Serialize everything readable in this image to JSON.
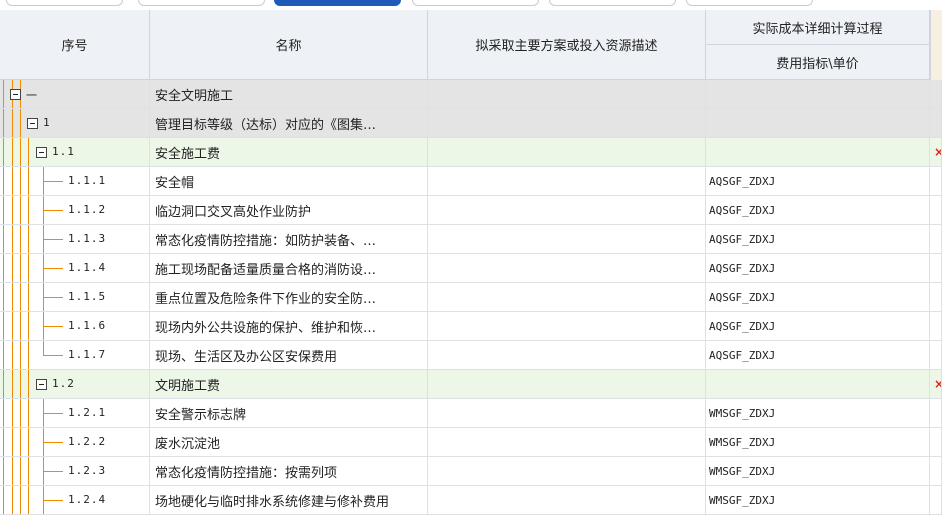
{
  "header": {
    "col_no": "序号",
    "col_name": "名称",
    "col_desc": "拟采取主要方案或投入资源描述",
    "group_cost": "实际成本详细计算过程",
    "col_index": "费用指标\\单价"
  },
  "rows": [
    {
      "level": 0,
      "no": "一",
      "name": "安全文明施工",
      "index": "",
      "expandable": true
    },
    {
      "level": 1,
      "no": "1",
      "name": "管理目标等级（达标）对应的《图集…",
      "index": "",
      "expandable": true
    },
    {
      "level": 2,
      "no": "1.1",
      "name": "安全施工费",
      "index": "",
      "expandable": true,
      "flag": "×"
    },
    {
      "level": 3,
      "no": "1.1.1",
      "name": "安全帽",
      "index": "AQSGF_ZDXJ"
    },
    {
      "level": 3,
      "no": "1.1.2",
      "name": "临边洞口交叉高处作业防护",
      "index": "AQSGF_ZDXJ"
    },
    {
      "level": 3,
      "no": "1.1.3",
      "name": "常态化疫情防控措施：如防护装备、…",
      "index": "AQSGF_ZDXJ"
    },
    {
      "level": 3,
      "no": "1.1.4",
      "name": "施工现场配备适量质量合格的消防设…",
      "index": "AQSGF_ZDXJ"
    },
    {
      "level": 3,
      "no": "1.1.5",
      "name": "重点位置及危险条件下作业的安全防…",
      "index": "AQSGF_ZDXJ"
    },
    {
      "level": 3,
      "no": "1.1.6",
      "name": "现场内外公共设施的保护、维护和恢…",
      "index": "AQSGF_ZDXJ"
    },
    {
      "level": 3,
      "no": "1.1.7",
      "name": "现场、生活区及办公区安保费用",
      "index": "AQSGF_ZDXJ",
      "last": true
    },
    {
      "level": 2,
      "no": "1.2",
      "name": "文明施工费",
      "index": "",
      "expandable": true,
      "flag": "×"
    },
    {
      "level": 3,
      "no": "1.2.1",
      "name": "安全警示标志牌",
      "index": "WMSGF_ZDXJ"
    },
    {
      "level": 3,
      "no": "1.2.2",
      "name": "废水沉淀池",
      "index": "WMSGF_ZDXJ"
    },
    {
      "level": 3,
      "no": "1.2.3",
      "name": "常态化疫情防控措施：按需列项",
      "index": "WMSGF_ZDXJ"
    },
    {
      "level": 3,
      "no": "1.2.4",
      "name": "场地硬化与临时排水系统修建与修补费用",
      "index": "WMSGF_ZDXJ"
    }
  ]
}
